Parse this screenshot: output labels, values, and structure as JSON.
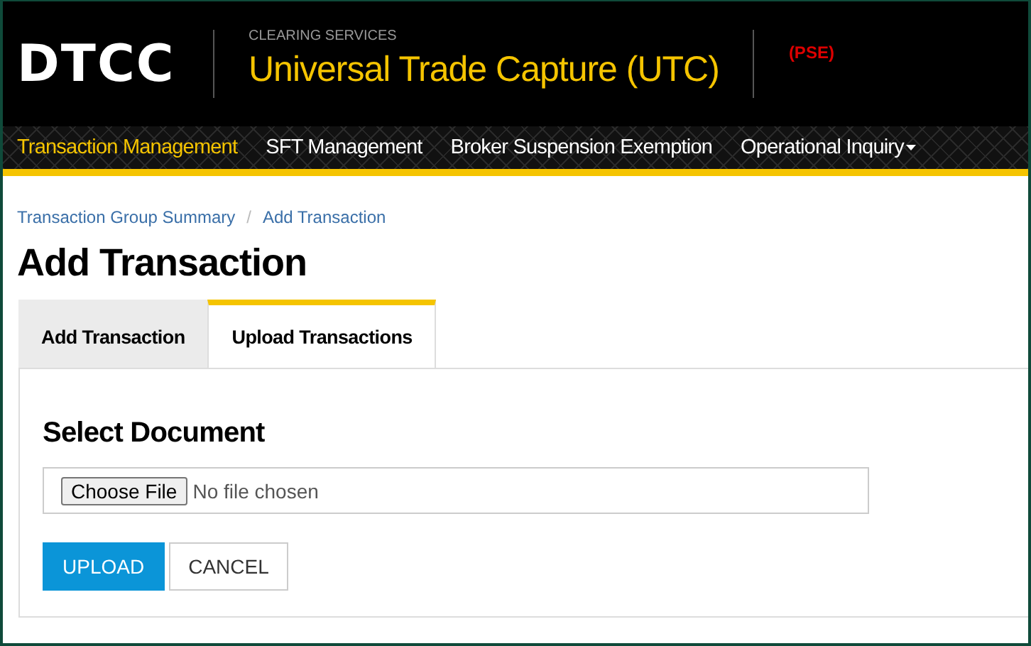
{
  "header": {
    "logo": "DTCC",
    "subtitle": "CLEARING SERVICES",
    "title": "Universal Trade Capture (UTC)",
    "environment": "(PSE)"
  },
  "nav": [
    {
      "label": "Transaction Management",
      "selected": true,
      "has_menu": false
    },
    {
      "label": "SFT Management",
      "selected": false,
      "has_menu": false
    },
    {
      "label": "Broker Suspension Exemption",
      "selected": false,
      "has_menu": false
    },
    {
      "label": "Operational Inquiry",
      "selected": false,
      "has_menu": true
    }
  ],
  "breadcrumb": {
    "items": [
      "Transaction Group Summary",
      "Add Transaction"
    ],
    "separator": "/"
  },
  "page_title": "Add Transaction",
  "tabs": [
    {
      "label": "Add Transaction",
      "selected": false
    },
    {
      "label": "Upload Transactions",
      "selected": true
    }
  ],
  "section_title": "Select Document",
  "file_field": {
    "button": "Choose File",
    "value": "No file chosen"
  },
  "buttons": [
    {
      "label": "UPLOAD",
      "kind": "primary"
    },
    {
      "label": "CANCEL",
      "kind": "secondary"
    }
  ]
}
